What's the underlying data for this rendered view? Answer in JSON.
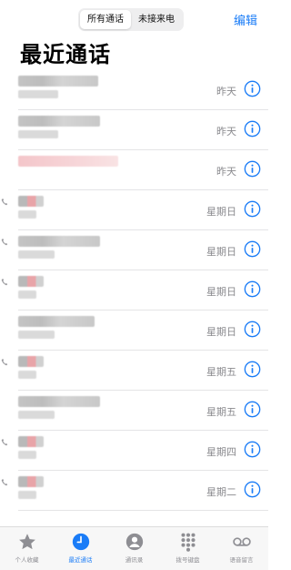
{
  "header": {
    "tabs": [
      {
        "label": "所有通话",
        "active": true
      },
      {
        "label": "未接来电",
        "active": false
      }
    ],
    "edit_label": "编辑",
    "title": "最近通话"
  },
  "calls": [
    {
      "time": "昨天",
      "outgoing": false,
      "missed": false
    },
    {
      "time": "昨天",
      "outgoing": false,
      "missed": false
    },
    {
      "time": "昨天",
      "outgoing": false,
      "missed": true
    },
    {
      "time": "星期日",
      "outgoing": true,
      "missed": false
    },
    {
      "time": "星期日",
      "outgoing": true,
      "missed": false
    },
    {
      "time": "星期日",
      "outgoing": true,
      "missed": false
    },
    {
      "time": "星期日",
      "outgoing": false,
      "missed": false
    },
    {
      "time": "星期五",
      "outgoing": true,
      "missed": false
    },
    {
      "time": "星期五",
      "outgoing": false,
      "missed": false
    },
    {
      "time": "星期四",
      "outgoing": true,
      "missed": false
    },
    {
      "time": "星期二",
      "outgoing": true,
      "missed": false
    }
  ],
  "tabbar": {
    "items": [
      {
        "label": "个人收藏",
        "icon": "star-icon",
        "active": false
      },
      {
        "label": "最近通话",
        "icon": "clock-icon",
        "active": true
      },
      {
        "label": "通讯录",
        "icon": "contacts-icon",
        "active": false
      },
      {
        "label": "拨号键盘",
        "icon": "keypad-icon",
        "active": false
      },
      {
        "label": "语音留言",
        "icon": "voicemail-icon",
        "active": false
      }
    ]
  },
  "colors": {
    "accent": "#1a7cf7",
    "missed": "#f2b8bc",
    "blur": "#c4c4c4"
  }
}
